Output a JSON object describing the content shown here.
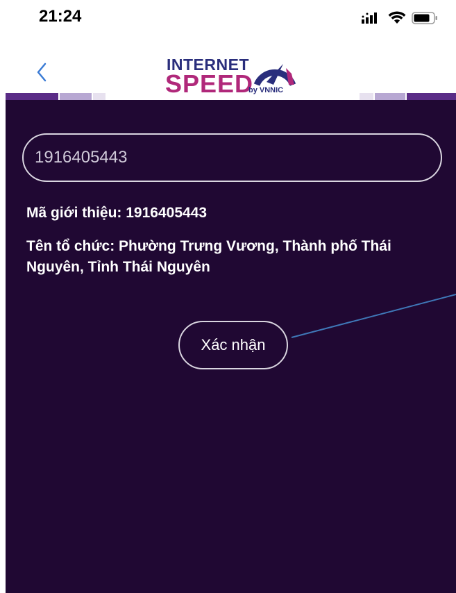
{
  "status_bar": {
    "time": "21:24",
    "icons": [
      "cellular-signal-icon",
      "wifi-icon",
      "battery-icon"
    ]
  },
  "header": {
    "back_icon": "chevron-left-icon",
    "logo": {
      "line1": "INTERNET",
      "line2": "SPEED",
      "line3": "by VNNIC"
    }
  },
  "form": {
    "code_value": "1916405443",
    "code_placeholder": "1916405443",
    "referral_code_text": "Mã giới thiệu: 1916405443",
    "organization_text": "Tên tổ chức: Phường Trưng Vương, Thành phố Thái Nguyên, Tỉnh Thái Nguyên",
    "confirm_label": "Xác nhận"
  },
  "colors": {
    "background_dark": "#200833",
    "accent_blue": "#2a2e7c",
    "accent_magenta": "#b0287a",
    "back_chevron": "#3a7bd5",
    "annotation_line": "#3f78b8"
  }
}
